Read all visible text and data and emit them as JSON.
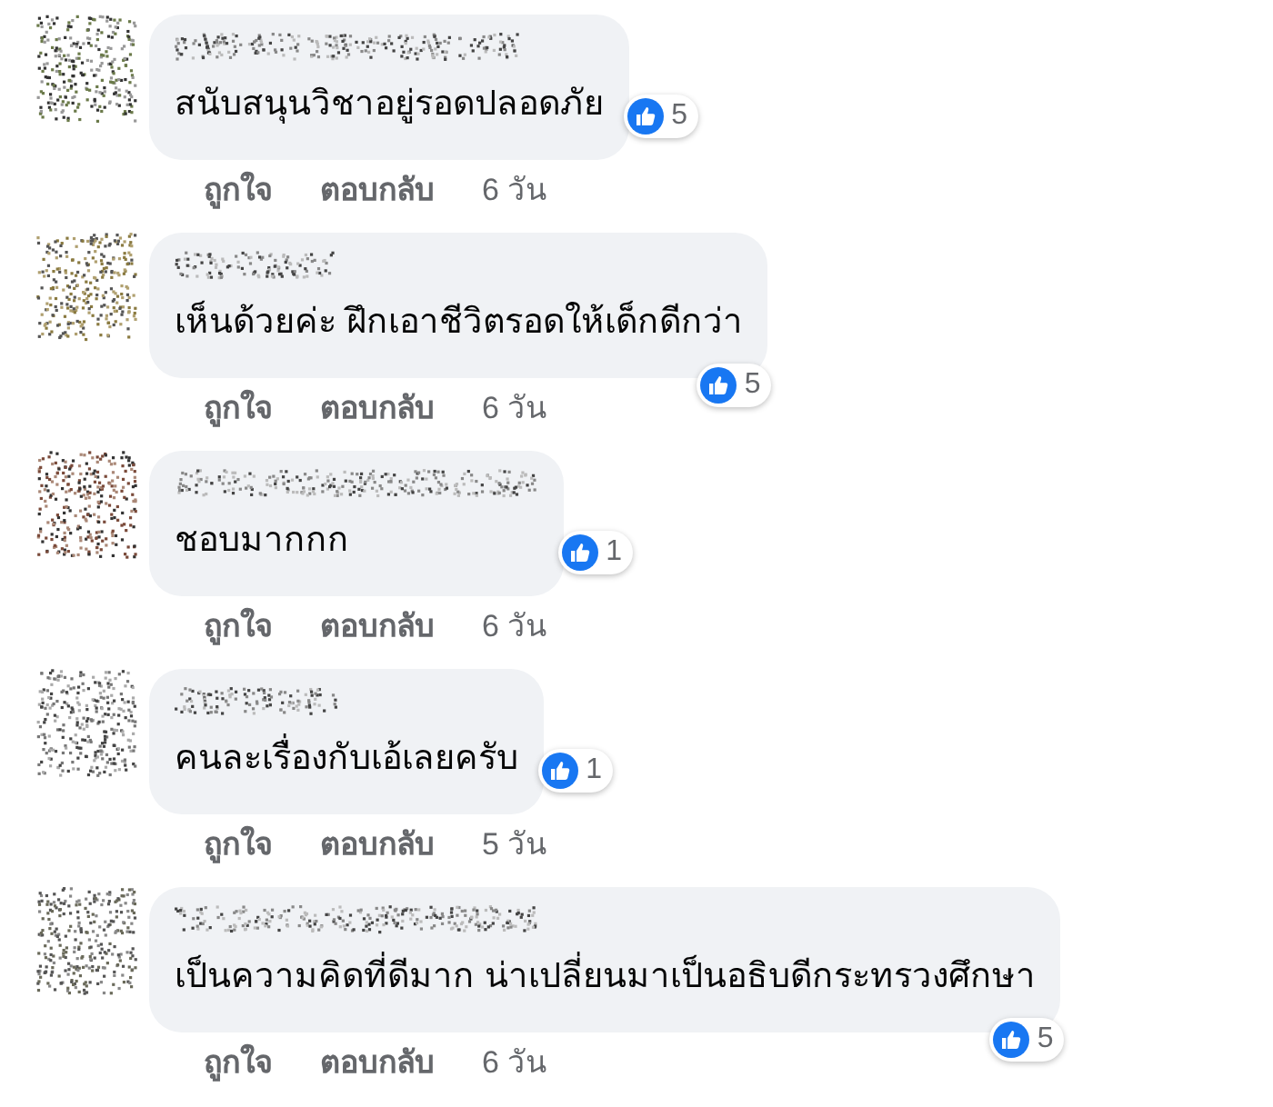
{
  "comments": [
    {
      "text": "สนับสนุนวิชาอยู่รอดปลอดภัย",
      "reactions": "5",
      "kind": "inline",
      "like": "ถูกใจ",
      "reply": "ตอบกลับ",
      "time": "6 วัน"
    },
    {
      "text": "เห็นด้วยค่ะ ฝึกเอาชีวิตรอดให้เด็กดีกว่า",
      "reactions": "5",
      "kind": "below",
      "like": "ถูกใจ",
      "reply": "ตอบกลับ",
      "time": "6 วัน"
    },
    {
      "text": "ชอบมากกก",
      "reactions": "1",
      "kind": "inline",
      "like": "ถูกใจ",
      "reply": "ตอบกลับ",
      "time": "6 วัน"
    },
    {
      "text": "คนละเรื่องกับเอ้เลยครับ",
      "reactions": "1",
      "kind": "inline",
      "like": "ถูกใจ",
      "reply": "ตอบกลับ",
      "time": "5 วัน"
    },
    {
      "text": "เป็นความคิดที่ดีมาก น่าเปลี่ยนมาเป็นอธิบดีกระทรวงศึกษา",
      "reactions": "5",
      "kind": "below",
      "like": "ถูกใจ",
      "reply": "ตอบกลับ",
      "time": "6 วัน"
    }
  ]
}
